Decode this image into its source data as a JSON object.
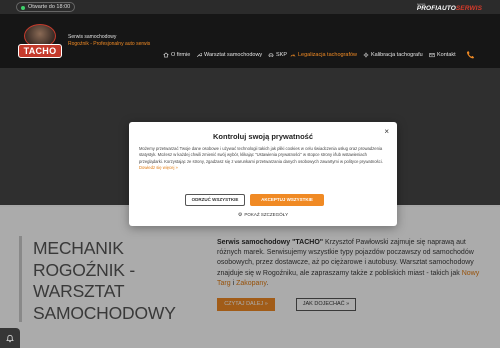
{
  "topbar": {
    "hours": "Otwarte do 18:00",
    "partner_sub": "serwis",
    "partner_main": "PROFIAUTO",
    "partner_main2": "SERWIS"
  },
  "header": {
    "logo_text": "TACHO",
    "brand_line1": "Serwis samochodowy",
    "brand_line2": "Rogoźnik - Profesjonalny auto serwis",
    "nav": [
      {
        "label": "O firmie",
        "icon": "home-icon"
      },
      {
        "label": "Warsztat samochodowy",
        "icon": "wrench-icon"
      },
      {
        "label": "SKP",
        "icon": "car-icon"
      },
      {
        "label": "Legalizacja tachografów",
        "icon": "gauge-icon"
      },
      {
        "label": "Kalibracja tachografu",
        "icon": "settings-icon"
      },
      {
        "label": "Kontakt",
        "icon": "mail-icon"
      }
    ],
    "phone_icon": "phone-icon"
  },
  "content": {
    "title": "MECHANIK ROGOŹNIK - WARSZTAT SAMOCHODOWY",
    "brand": "Serwis samochodowy \"TACHO\"",
    "text1": " Krzysztof Pawłowski zajmuje się naprawą aut różnych marek. Serwisujemy wszystkie typy pojazdów poczawszy od samochodów osobowych, przez dostawcze, aż po ciężarowe i autobusy. Warsztat samochodowy znajduje się w Rogoźniku, ale zapraszamy także z pobliskich miast - takich jak ",
    "link1": "Nowy Targ",
    "and": " i ",
    "link2": "Zakopany",
    "end": ".",
    "btn_read": "CZYTAJ DALEJ »",
    "btn_drive": "JAK DOJECHAĆ »"
  },
  "cookie": {
    "title": "Kontroluj swoją prywatność",
    "body": "Możemy przetwarzać Twoje dane osobowe i używać technologii takich jak pliki cookies w celu świadczenia usług oraz prowadzenia statystyk. Możesz w każdej chwili zmienić swój wybór, klikając \"Ustawienia prywatności\" w stopce strony i/lub wstawieniach przeglądarki. Korzystając ze strony, zgadzasz się z warunkami przetwarzania danych osobowych zawartymi w polityce prywatności.",
    "more": "Dowiedz się więcej »",
    "reject": "ODRZUĆ WSZYSTKIE",
    "accept": "AKCEPTUJ WSZYSTKIE",
    "details": "POKAŻ SZCZEGÓŁY",
    "close": "×"
  },
  "colors": {
    "accent": "#f08a24",
    "brand_red": "#c43a2c",
    "header_bg": "#161616"
  }
}
